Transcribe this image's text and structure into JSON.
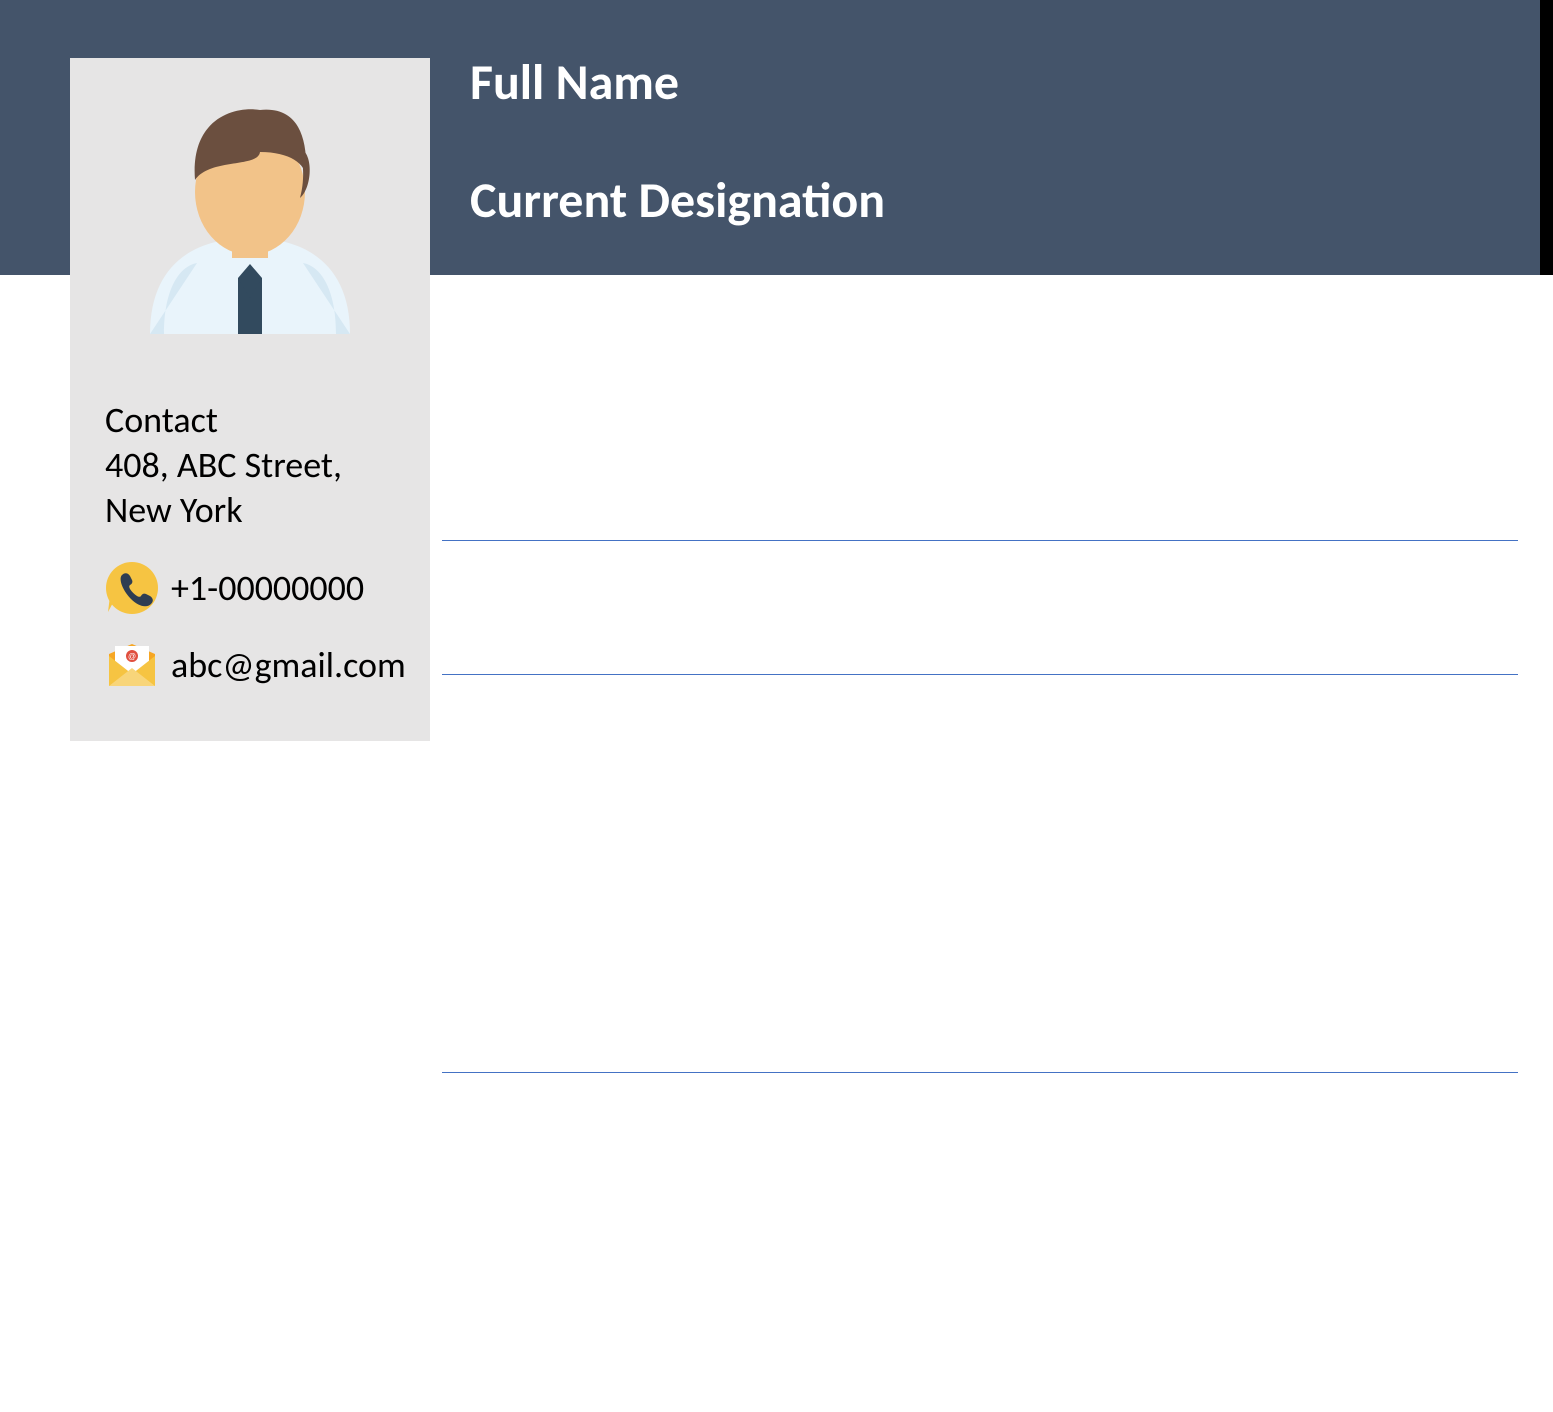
{
  "header": {
    "full_name": "Full Name",
    "designation": "Current Designation"
  },
  "sidebar": {
    "contact_label": "Contact",
    "address_line1": "408, ABC Street,",
    "address_line2": "New York",
    "phone": "+1-00000000",
    "email": "abc@gmail.com"
  }
}
